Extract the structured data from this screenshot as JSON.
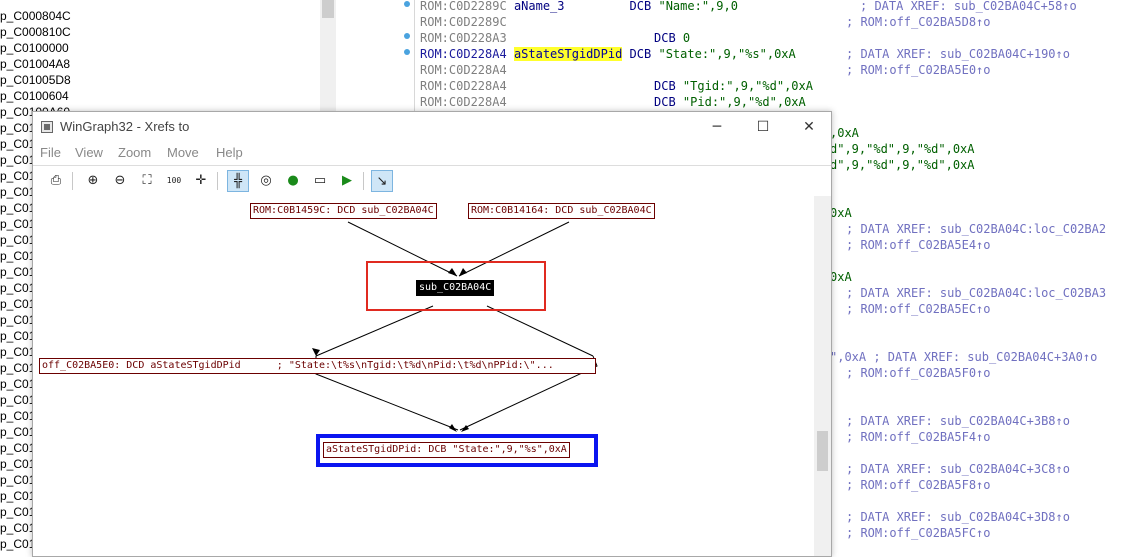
{
  "function_list": {
    "items": [
      "p_C000804C",
      "p_C000810C",
      "p_C0100000",
      "p_C01004A8",
      "p_C01005D8",
      "p_C0100604",
      "p_C0100A60",
      "p_C01",
      "p_C01",
      "p_C01",
      "p_C01",
      "p_C01",
      "p_C01",
      "p_C01",
      "p_C01",
      "p_C01",
      "p_C01",
      "p_C01",
      "p_C01",
      "p_C01",
      "p_C01",
      "p_C01",
      "p_C01",
      "p_C01",
      "p_C01",
      "p_C01",
      "p_C01",
      "p_C01",
      "p_C01",
      "p_C01",
      "p_C01",
      "p_C01",
      "p_C01",
      "p_C01"
    ]
  },
  "disasm": {
    "lines": [
      {
        "addr": "ROM:C0D2289C",
        "label": "aName_3",
        "op": "DCB",
        "args": "\"Name:\",9,0",
        "comment": "; DATA XREF: sub_C02BA04C+58↑o"
      },
      {
        "addr": "ROM:C0D2289C",
        "label": "",
        "op": "",
        "args": "",
        "comment": "; ROM:off_C02BA5D8↑o"
      },
      {
        "addr": "ROM:C0D228A3",
        "label": "",
        "op": "DCB",
        "args": "0",
        "comment": ""
      },
      {
        "addr": "ROM:C0D228A4",
        "label": "aStateSTgidDPid",
        "op": "DCB",
        "args": "\"State:\",9,\"%s\",0xA",
        "comment": "; DATA XREF: sub_C02BA04C+190↑o"
      },
      {
        "addr": "ROM:C0D228A4",
        "label": "",
        "op": "",
        "args": "",
        "comment": "; ROM:off_C02BA5E0↑o"
      },
      {
        "addr": "ROM:C0D228A4",
        "label": "",
        "op": "DCB",
        "args": "\"Tgid:\",9,\"%d\",0xA",
        "comment": ""
      },
      {
        "addr": "ROM:C0D228A4",
        "label": "",
        "op": "DCB",
        "args": "\"Pid:\",9,\"%d\",0xA",
        "comment": ""
      }
    ],
    "fragments": [
      {
        "text": ",0xA"
      },
      {
        "text": "d\",9,\"%d\",9,\"%d\",0xA"
      },
      {
        "text": "d\",9,\"%d\",9,\"%d\",0xA"
      },
      {
        "text": "0xA"
      },
      {
        "text": "; DATA XREF: sub_C02BA04C:loc_C02BA2"
      },
      {
        "text": "; ROM:off_C02BA5E4↑o"
      },
      {
        "text": "0xA"
      },
      {
        "text": "; DATA XREF: sub_C02BA04C:loc_C02BA3"
      },
      {
        "text": "; ROM:off_C02BA5EC↑o"
      },
      {
        "text": "\",0xA ; DATA XREF: sub_C02BA04C+3A0↑o"
      },
      {
        "text": "; ROM:off_C02BA5F0↑o"
      },
      {
        "text": "; DATA XREF: sub_C02BA04C+3B8↑o"
      },
      {
        "text": "; ROM:off_C02BA5F4↑o"
      },
      {
        "text": "; DATA XREF: sub_C02BA04C+3C8↑o"
      },
      {
        "text": "; ROM:off_C02BA5F8↑o"
      },
      {
        "text": "; DATA XREF: sub_C02BA04C+3D8↑o"
      },
      {
        "text": "; ROM:off_C02BA5FC↑o"
      }
    ]
  },
  "wingraph": {
    "title": "WinGraph32 - Xrefs to",
    "controls": {
      "minimize": "─",
      "maximize": "☐",
      "close": "✕"
    },
    "menu": [
      "File",
      "View",
      "Zoom",
      "Move",
      "Help"
    ],
    "toolbar": {
      "zoom100": "100"
    },
    "nodes": {
      "ref1": "ROM:C0B1459C: DCD sub_C02BA04C",
      "ref2": "ROM:C0B14164: DCD sub_C02BA04C",
      "func": "sub_C02BA04C",
      "off": "off_C02BA5E0: DCD aStateSTgidDPid      ; \"State:\\t%s\\nTgid:\\t%d\\nPid:\\t%d\\nPPid:\\\"...",
      "target": "aStateSTgidDPid: DCB \"State:\",9,\"%s\",0xA"
    }
  }
}
